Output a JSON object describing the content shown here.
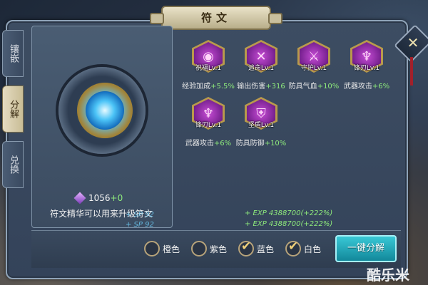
{
  "title": "符文",
  "close_label": "✕",
  "tabs": [
    {
      "label": "镶嵌",
      "active": false
    },
    {
      "label": "分解",
      "active": true
    },
    {
      "label": "兑换",
      "active": false
    }
  ],
  "essence": {
    "value": "1056",
    "delta": "+0"
  },
  "hint": "符文精华可以用来升级符文",
  "fx_texts": [
    "+ SP 92",
    "+ SP 92"
  ],
  "runes": [
    {
      "name": "祝福Lv.1",
      "glyph": "◉",
      "attr_label": "经验加成",
      "attr_value": "+5.5%"
    },
    {
      "name": "追命Lv.1",
      "glyph": "✕",
      "attr_label": "输出伤害",
      "attr_value": "+316"
    },
    {
      "name": "守护Lv.1",
      "glyph": "⚔",
      "attr_label": "防具气血",
      "attr_value": "+10%"
    },
    {
      "name": "锋刃Lv.1",
      "glyph": "♆",
      "attr_label": "武器攻击",
      "attr_value": "+6%"
    },
    {
      "name": "锋刃Lv.1",
      "glyph": "♆",
      "attr_label": "武器攻击",
      "attr_value": "+6%"
    },
    {
      "name": "坚盾Lv.1",
      "glyph": "⛨",
      "attr_label": "防具防御",
      "attr_value": "+10%"
    }
  ],
  "exp_lines": [
    "+ EXP 4388700(+222%)",
    "+ EXP 4388700(+222%)"
  ],
  "filters": [
    {
      "label": "橙色",
      "checked": false
    },
    {
      "label": "紫色",
      "checked": false
    },
    {
      "label": "蓝色",
      "checked": true
    },
    {
      "label": "白色",
      "checked": true
    }
  ],
  "decompose_button": "一键分解",
  "watermark": "酷乐米",
  "colors": {
    "accent_green": "#8eea7c",
    "rune_purple": "#6c1b86",
    "button_cyan": "#12879a"
  }
}
